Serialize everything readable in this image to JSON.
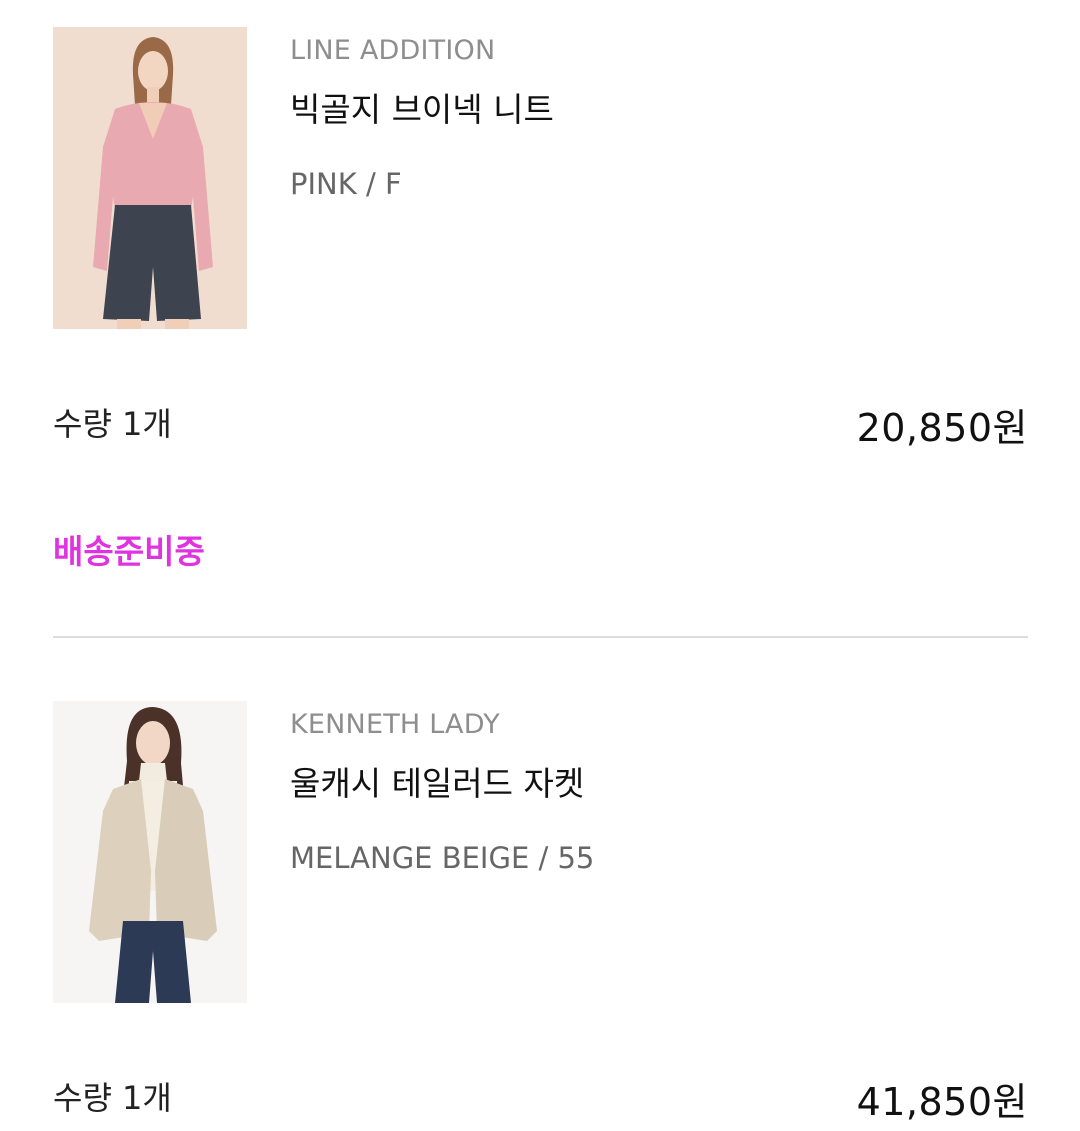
{
  "colors": {
    "status": "#e033e0",
    "brand_text": "#8e8e8e",
    "option_text": "#666666",
    "divider": "#dddddd"
  },
  "items": [
    {
      "brand": "LINE ADDITION",
      "name": "빅골지 브이넥 니트",
      "option": "PINK / F",
      "quantity": "수량 1개",
      "price": "20,850원",
      "status": "배송준비중",
      "image": "product-photo-pink-knit"
    },
    {
      "brand": "KENNETH LADY",
      "name": "울캐시 테일러드 자켓",
      "option": "MELANGE BEIGE / 55",
      "quantity": "수량 1개",
      "price": "41,850원",
      "image": "product-photo-beige-jacket"
    }
  ]
}
